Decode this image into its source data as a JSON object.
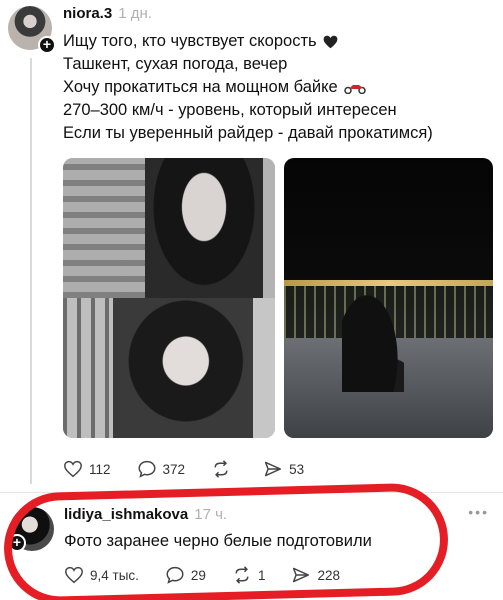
{
  "post1": {
    "username": "niora.3",
    "time": "1 дн.",
    "lines": [
      "Ищу того, кто чувствует скорость",
      "Ташкент, сухая погода, вечер",
      "Хочу прокатиться на мощном байке",
      "270–300 км/ч - уровень, который интересен",
      "Если ты уверенный райдер - давай прокатимся)"
    ],
    "likes": "112",
    "comments": "372",
    "reposts": "",
    "shares": "53"
  },
  "post2": {
    "username": "lidiya_ishmakova",
    "time": "17 ч.",
    "text": "Фото заранее черно белые подготовили",
    "likes": "9,4 тыс.",
    "comments": "29",
    "reposts": "1",
    "shares": "228"
  },
  "colors": {
    "highlight": "#e51e25",
    "heart_emoji": "#222222",
    "moto_emoji": "#d0242c"
  },
  "icons": {
    "like": "heart-outline-icon",
    "comment": "speech-bubble-icon",
    "repost": "repost-arrows-icon",
    "share": "send-icon",
    "more": "more-dots-icon"
  }
}
